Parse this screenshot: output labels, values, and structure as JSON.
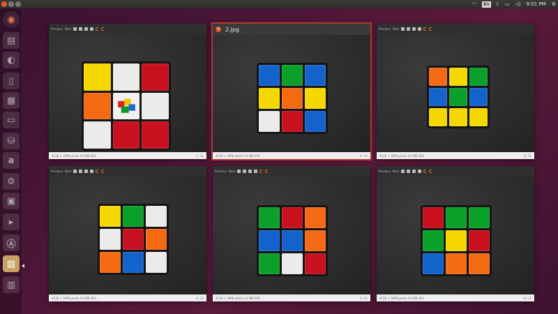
{
  "panel": {
    "keyboard_layout": "En",
    "time": "9:51 PM",
    "tray_icons": [
      "network-icon",
      "keyboard-layout-indicator",
      "bluetooth-icon",
      "battery-icon",
      "volume-icon",
      "settings-gear-icon"
    ]
  },
  "launcher": {
    "items": [
      {
        "name": "dash-home-icon",
        "glyph": "◉"
      },
      {
        "name": "files-icon",
        "glyph": "▤"
      },
      {
        "name": "firefox-icon",
        "glyph": "◐"
      },
      {
        "name": "writer-icon",
        "glyph": "▯"
      },
      {
        "name": "calc-icon",
        "glyph": "▦"
      },
      {
        "name": "impress-icon",
        "glyph": "▭"
      },
      {
        "name": "software-center-icon",
        "glyph": "⛁"
      },
      {
        "name": "amazon-icon",
        "glyph": "a"
      },
      {
        "name": "system-settings-icon",
        "glyph": "⚙"
      },
      {
        "name": "monitor-icon",
        "glyph": "▣"
      },
      {
        "name": "terminal-icon",
        "glyph": "▸"
      },
      {
        "name": "updater-icon",
        "glyph": "Ⓐ"
      },
      {
        "name": "image-viewer-icon",
        "glyph": "▨"
      },
      {
        "name": "trash-icon",
        "glyph": "▥"
      }
    ]
  },
  "toolbar": {
    "previous_label": "Previous",
    "next_label": "Next"
  },
  "focused_title": "2.jpg",
  "colors": {
    "W": "#ebebe9",
    "R": "#c8101e",
    "G": "#0aa02a",
    "B": "#1463cc",
    "Y": "#f5d800",
    "O": "#f46a12"
  },
  "windows": [
    {
      "faces": [
        "Y",
        "W",
        "R",
        "O",
        "L",
        "W",
        "W",
        "R",
        "R"
      ],
      "status": "4128 × 3096 pixels  3.9 MB   22%",
      "page": "1 / 11"
    },
    {
      "faces": [
        "B",
        "G",
        "B",
        "Y",
        "O",
        "Y",
        "W",
        "R",
        "B"
      ],
      "status": "4128 × 3096 pixels  4.1 MB   22%",
      "page": "2 / 11"
    },
    {
      "faces": [
        "O",
        "Y",
        "G",
        "B",
        "G",
        "B",
        "Y",
        "Y",
        "Y"
      ],
      "status": "4128 × 3096 pixels  4.2 MB   22%",
      "page": "3 / 11"
    },
    {
      "faces": [
        "Y",
        "G",
        "W",
        "W",
        "R",
        "O",
        "O",
        "B",
        "W"
      ],
      "status": "4128 × 3096 pixels  4.0 MB   22%",
      "page": "4 / 11"
    },
    {
      "faces": [
        "G",
        "R",
        "O",
        "B",
        "B",
        "O",
        "G",
        "W",
        "R"
      ],
      "status": "4128 × 3096 pixels  4.1 MB   22%",
      "page": "5 / 11"
    },
    {
      "faces": [
        "R",
        "G",
        "G",
        "G",
        "Y",
        "R",
        "B",
        "O",
        "O"
      ],
      "status": "4128 × 3096 pixels  4.0 MB   22%",
      "page": "6 / 11"
    }
  ]
}
